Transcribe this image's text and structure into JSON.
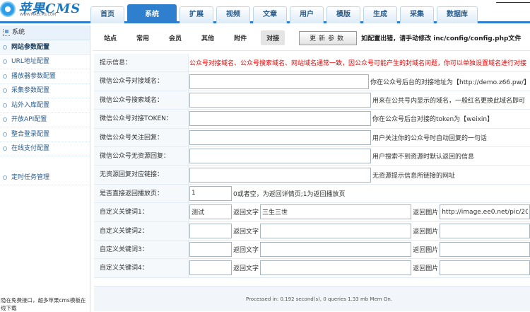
{
  "brand": {
    "name": "苹果CMS",
    "url": "WWW.MACCMS.COM"
  },
  "nav": [
    "首页",
    "系统",
    "扩展",
    "视频",
    "文章",
    "用户",
    "模版",
    "生成",
    "采集",
    "数据库"
  ],
  "sidebar": {
    "title": "系统",
    "items": [
      "网站参数配置",
      "URL地址配置",
      "播放器参数配置",
      "采集参数配置",
      "站外入库配置",
      "开放API配置",
      "整合登录配置",
      "在线支付配置"
    ],
    "extra": "定时任务管理",
    "footer": "隐在免费接口，超多苹果cms模板在线下载"
  },
  "subtabs": [
    "站点",
    "常用",
    "会员",
    "其他",
    "附件",
    "对接"
  ],
  "update_button": "更新参数",
  "update_note": "如配置出错，请手动修改 inc/config/config.php文件",
  "form": {
    "notice_label": "提示信息：",
    "notice_text": "公众号对接域名、公众号搜索域名、网站域名通常一致，因公众号可能产生的封域名问题，你可以单独设置域名进行对接",
    "rows": [
      {
        "label": "微信公众号对接域名：",
        "value": "",
        "desc": "你在公众号后台的对接地址为【http://demo.z66.pw/】"
      },
      {
        "label": "微信公众号搜索域名：",
        "value": "",
        "desc": "用来在公共号内显示的域名，一般红名更换此域名即可"
      },
      {
        "label": "微信公众号对接TOKEN：",
        "value": "",
        "desc": "你在公众号后台对接的token为【weixin】"
      },
      {
        "label": "微信公众号关注回复：",
        "value": "",
        "desc": "用户关注你的公众号时自动回复的一句话"
      },
      {
        "label": "微信公众号无资源回复：",
        "value": "",
        "desc": "用户搜索不到资源时默认返回的信息"
      },
      {
        "label": "无资源回复对应链接：",
        "value": "",
        "desc": "无资源提示信息所链接的网址"
      }
    ],
    "direct_label": "是否直接返回播放页：",
    "direct_value": "1",
    "direct_desc": "0或者空，为返回详情页;1为返回播放页",
    "return_text_label": "返回文字",
    "return_image_label": "返回图片",
    "keywords": [
      {
        "label": "自定义关键词1：",
        "keyword": "测试",
        "text": "三生三世",
        "image": "http://image.ee0.net/pic/20"
      },
      {
        "label": "自定义关键词2：",
        "keyword": "",
        "text": "",
        "image": ""
      },
      {
        "label": "自定义关键词3：",
        "keyword": "",
        "text": "",
        "image": ""
      },
      {
        "label": "自定义关键词4：",
        "keyword": "",
        "text": "",
        "image": ""
      }
    ]
  },
  "footer_text": "Processed in: 0.192 second(s), 0 queries 1.33 mb Mem On."
}
